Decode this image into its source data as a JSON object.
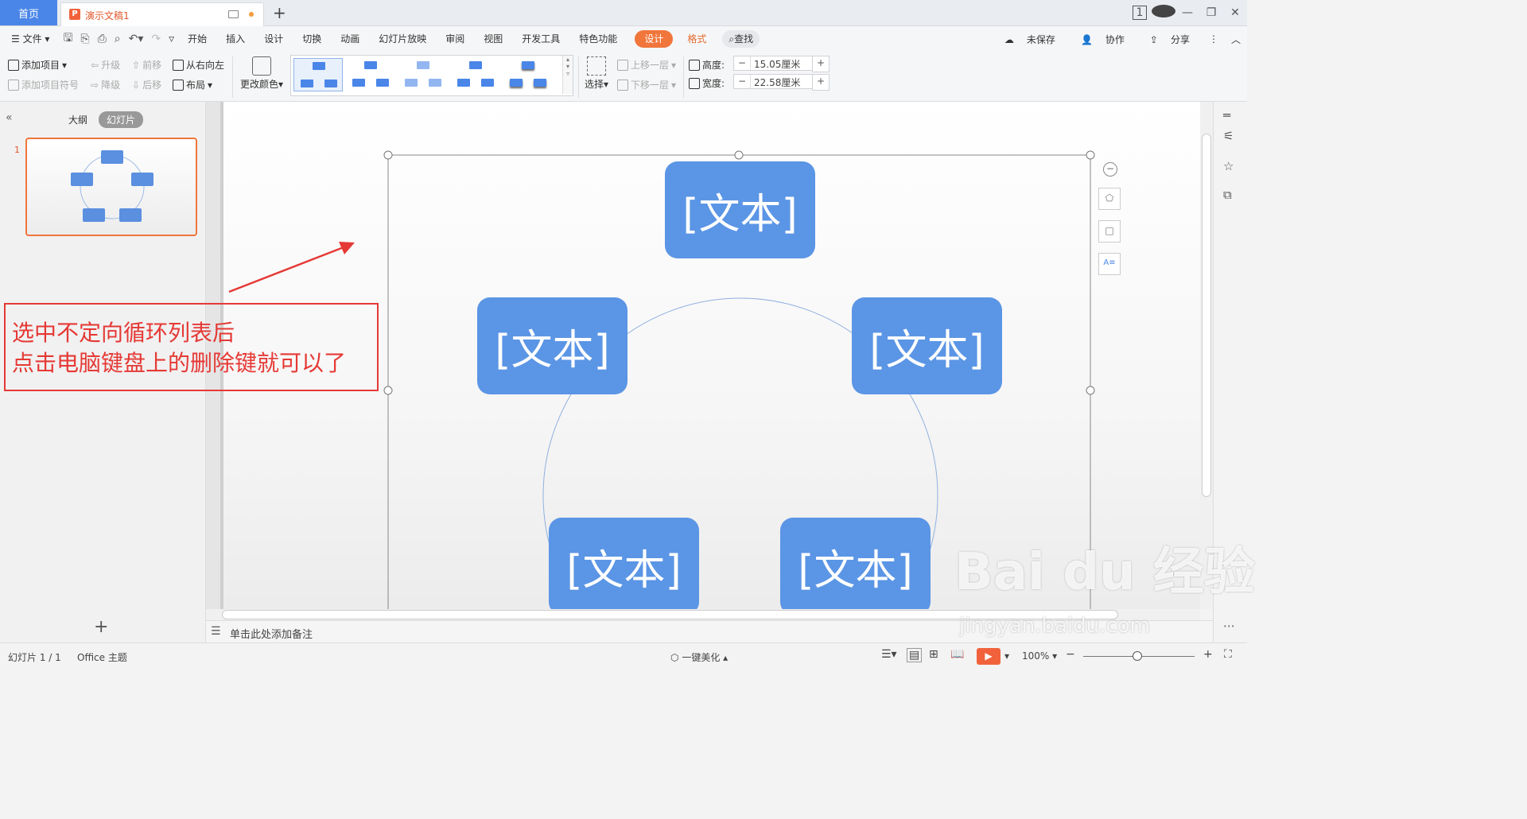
{
  "titlebar": {
    "home_tab": "首页",
    "doc_icon": "P",
    "doc_title": "演示文稿1",
    "add_tab": "+",
    "badge": "1"
  },
  "menu": {
    "file": "文件",
    "items": [
      "开始",
      "插入",
      "设计",
      "切换",
      "动画",
      "幻灯片放映",
      "审阅",
      "视图",
      "开发工具",
      "特色功能"
    ],
    "design_active": "设计",
    "format": "格式",
    "search": "查找",
    "unsaved": "未保存",
    "collab": "协作",
    "share": "分享"
  },
  "ribbon": {
    "add_item": "添加项目",
    "add_bullet": "添加项目符号",
    "promote": "升级",
    "demote": "降级",
    "move_up": "前移",
    "move_down": "后移",
    "rtl": "从右向左",
    "layout": "布局",
    "change_color": "更改颜色",
    "select": "选择",
    "bring_forward": "上移一层",
    "send_backward": "下移一层",
    "height_label": "高度:",
    "height_value": "15.05厘米",
    "width_label": "宽度:",
    "width_value": "22.58厘米"
  },
  "left_panel": {
    "tab_outline": "大纲",
    "tab_slides": "幻灯片",
    "slide_number": "1"
  },
  "smartart": {
    "node_text": "[文本]",
    "node_color": "#5b95e5"
  },
  "annotation": {
    "line1": "选中不定向循环列表后",
    "line2": "点击电脑键盘上的删除键就可以了",
    "color": "#e53935"
  },
  "notes": {
    "placeholder": "单击此处添加备注"
  },
  "status": {
    "slide_info": "幻灯片 1 / 1",
    "theme": "Office 主题",
    "beautify": "一键美化",
    "zoom": "100%"
  },
  "watermark": {
    "logo": "Bai du 经验",
    "url": "jingyan.baidu.com"
  }
}
